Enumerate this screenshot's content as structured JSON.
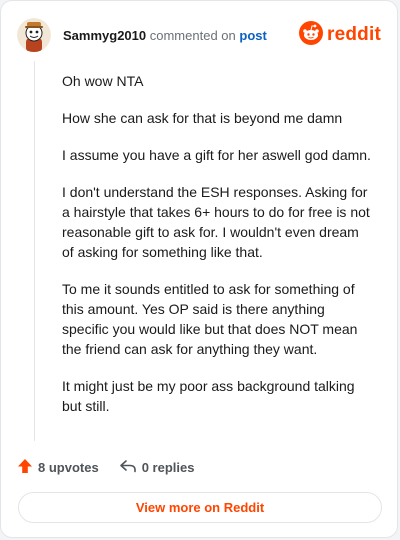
{
  "header": {
    "username": "Sammyg2010",
    "action_text": "commented on",
    "post_link": "post",
    "brand": "reddit"
  },
  "comment": {
    "paragraphs": [
      "Oh wow NTA",
      "How she can ask for that is beyond me damn",
      "I assume you have a gift for her aswell god damn.",
      "I don't understand the ESH responses. Asking for a hairstyle that takes 6+ hours to do for free is not reasonable gift to ask for. I wouldn't even dream of asking for something like that.",
      "To me it sounds entitled to ask for something of this amount. Yes OP said is there anything specific you would like but that does NOT mean the friend can ask for anything they want.",
      "It might just be my poor ass background talking but still."
    ]
  },
  "actions": {
    "upvotes": "8 upvotes",
    "replies": "0 replies"
  },
  "footer": {
    "view_more": "View more on Reddit"
  },
  "colors": {
    "brand": "#ff4500",
    "link": "#0b60c4",
    "text": "#1a1a1b",
    "muted": "#6b7177"
  },
  "icons": [
    "avatar",
    "reddit-logo-icon",
    "upvote-arrow-icon",
    "reply-icon"
  ]
}
